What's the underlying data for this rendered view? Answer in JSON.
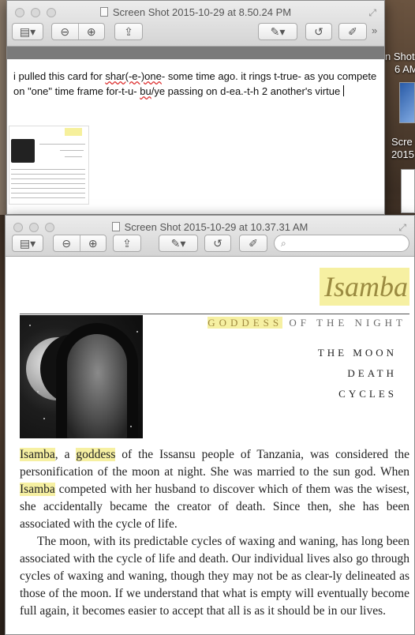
{
  "window_back": {
    "title": "Screen Shot 2015-10-29 at 8.50.24 PM",
    "note_parts": [
      "i pulled this card for ",
      "shar(-e-)one",
      "- some time ago. it rings t-true- as you compete on \"one\" time frame for-t-u-  ",
      "bu",
      "/ye passing on d-ea.-t-h 2 another's virtue "
    ]
  },
  "window_front": {
    "title": "Screen Shot 2015-10-29 at 10.37.31 AM",
    "search_placeholder": ""
  },
  "desktop": {
    "labels": [
      "n Shot",
      "6 AM",
      "Scre",
      "2015"
    ]
  },
  "document": {
    "heading": "Isamba",
    "subtitle_hl": "GODDESS",
    "subtitle_rest": " OF THE NIGHT",
    "terms": [
      "THE MOON",
      "DEATH",
      "CYCLES"
    ],
    "p1": {
      "w1": "Isamba",
      "t1": ", a ",
      "w2": "goddess",
      "t2": " of the Issansu people of Tanzania, was considered the personification of the moon at night. She was married to the sun god. When ",
      "w3": "Isamba",
      "t3": " competed with her husband to discover which of them was the wisest, she accidentally became the creator of death. Since then, she has been associated with the cycle of life."
    },
    "p2": "The moon, with its predictable cycles of waxing and waning, has long been associated with the cycle of life and death. Our individual lives also go through cycles of waxing and waning, though they may not be as clear-ly delineated as those of the moon. If we understand that what is empty will eventually become full again, it becomes easier to accept that all is as it should be in our lives."
  },
  "icons": [
    "sidebar-icon",
    "zoom-out-icon",
    "zoom-in-icon",
    "share-icon",
    "markup-pen-icon",
    "rotate-icon",
    "edit-toolbox-icon",
    "search-icon",
    "fullscreen-icon",
    "more-chevron-icon"
  ]
}
